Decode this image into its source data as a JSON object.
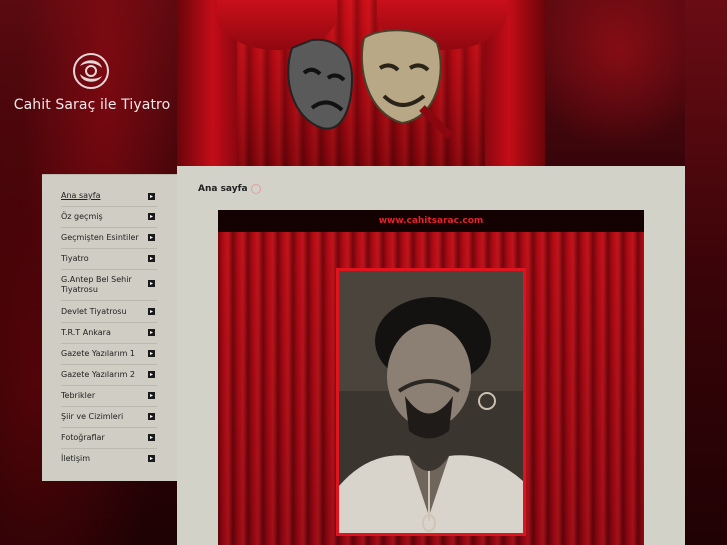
{
  "site": {
    "title": "Cahit Saraç ile Tiyatro"
  },
  "nav": {
    "items": [
      {
        "label": "Ana sayfa",
        "active": true
      },
      {
        "label": "Öz geçmiş"
      },
      {
        "label": "Geçmişten Esintiler"
      },
      {
        "label": "Tiyatro"
      },
      {
        "label": "G.Antep Bel Sehir Tiyatrosu"
      },
      {
        "label": "Devlet Tiyatrosu"
      },
      {
        "label": "T.R.T Ankara"
      },
      {
        "label": "Gazete Yazılarım 1"
      },
      {
        "label": "Gazete Yazılarım 2"
      },
      {
        "label": "Tebrikler"
      },
      {
        "label": "Şiir ve Cizimleri"
      },
      {
        "label": "Fotoğraflar"
      },
      {
        "label": "İletişim"
      }
    ]
  },
  "content": {
    "title": "Ana sayfa"
  },
  "poster": {
    "url": "www.cahitsarac.com"
  },
  "colors": {
    "accent": "#e0141e",
    "background": "#2a0306",
    "panel": "#d3d2c9"
  }
}
